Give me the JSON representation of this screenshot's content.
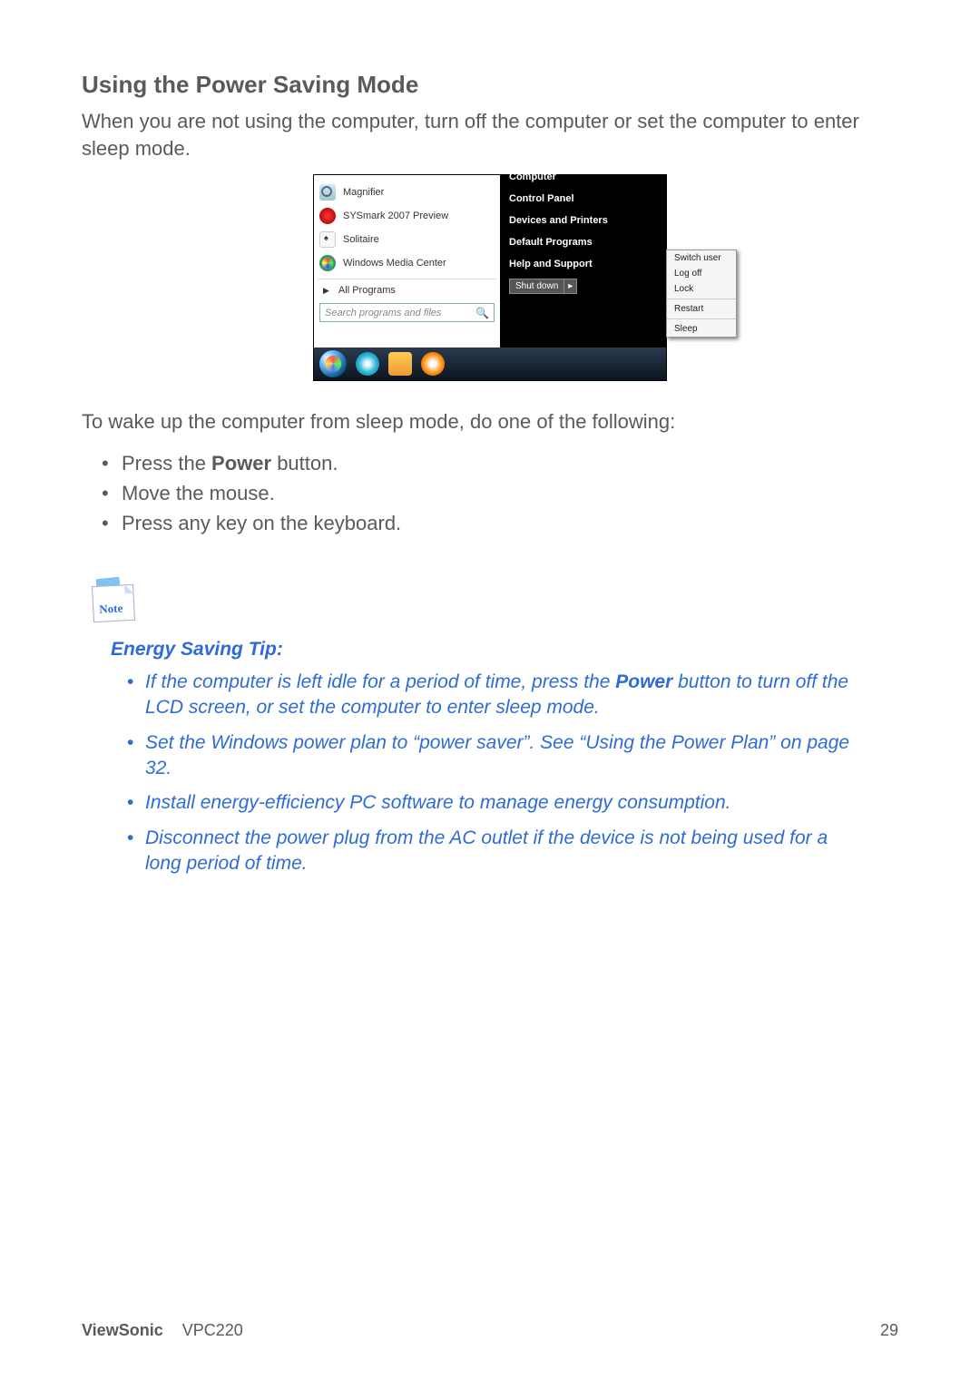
{
  "section_title": "Using the Power Saving Mode",
  "intro": "When you are not using the computer, turn off the computer or set the computer to enter sleep mode.",
  "screenshot": {
    "programs": {
      "magnifier": "Magnifier",
      "sysmark": "SYSmark 2007 Preview",
      "solitaire": "Solitaire",
      "wmc": "Windows Media Center",
      "all_programs": "All Programs"
    },
    "search_placeholder": "Search programs and files",
    "right_links": {
      "computer": "Computer",
      "control_panel": "Control Panel",
      "devices": "Devices and Printers",
      "default_programs": "Default Programs",
      "help": "Help and Support"
    },
    "shutdown_label": "Shut down",
    "shutdown_arrow": "▸",
    "power_menu": {
      "switch_user": "Switch user",
      "log_off": "Log off",
      "lock": "Lock",
      "restart": "Restart",
      "sleep": "Sleep"
    }
  },
  "wake_intro": "To wake up the computer from sleep mode, do one of the following:",
  "wake_list": {
    "press_the": "Press the ",
    "power": "Power",
    "button_period": " button.",
    "move_mouse": "Move the mouse.",
    "press_key": "Press any key on the keyboard."
  },
  "note_label": "Note",
  "tip_heading": "Energy Saving Tip:",
  "tips": {
    "t1a": "If the computer is left idle for a period of time, press the ",
    "t1b": "Power",
    "t1c": " button to turn off the LCD screen, or set the computer to enter sleep mode.",
    "t2": "Set the Windows power plan to “power saver”. See “Using the Power Plan” on page 32.",
    "t3": "Install energy-efficiency PC software to manage energy consumption.",
    "t4": "Disconnect the power plug from the AC outlet if the device is not being used for a long period of time."
  },
  "footer": {
    "brand": "ViewSonic",
    "model": "VPC220",
    "page": "29"
  }
}
